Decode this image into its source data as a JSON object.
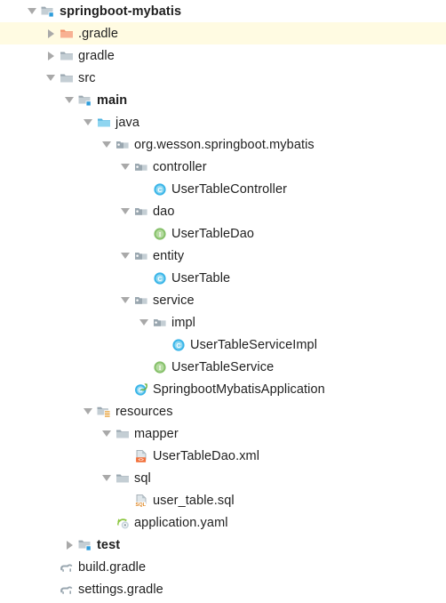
{
  "panel": {
    "name": "project-tool-window-tree",
    "background": "#ffffff",
    "selection_background": "#fffbe2",
    "text_color": "#1f1f1f",
    "arrow_color": "#a9a9a9"
  },
  "colors": {
    "folder_gray": "#9aa7b0",
    "folder_gray_light": "#c4ced4",
    "folder_orange": "#f2926b",
    "folder_orange_light": "#f8b193",
    "folder_blue": "#4eb3e0",
    "folder_blue_light": "#8fd5f0",
    "class_blue": "#3ab5e8",
    "interface_green": "#86c06a",
    "spring_green": "#6db33f",
    "badge_blue": "#2d9cdb",
    "resource_yellow": "#e8a33d",
    "xml_orange": "#f2703a",
    "sql_orange": "#e08b2b",
    "gradle_gray": "#9aa7b0"
  },
  "tree": {
    "rows": [
      {
        "label": "springboot-mybatis",
        "depth": 0,
        "arrow": "expanded",
        "icon": "module-folder-icon",
        "bold": true,
        "selected": false
      },
      {
        "label": ".gradle",
        "depth": 1,
        "arrow": "collapsed",
        "icon": "excluded-folder-icon",
        "bold": false,
        "selected": true
      },
      {
        "label": "gradle",
        "depth": 1,
        "arrow": "collapsed",
        "icon": "folder-icon",
        "bold": false,
        "selected": false
      },
      {
        "label": "src",
        "depth": 1,
        "arrow": "expanded",
        "icon": "folder-icon",
        "bold": false,
        "selected": false
      },
      {
        "label": "main",
        "depth": 2,
        "arrow": "expanded",
        "icon": "module-folder-icon",
        "bold": true,
        "selected": false
      },
      {
        "label": "java",
        "depth": 3,
        "arrow": "expanded",
        "icon": "source-root-folder-icon",
        "bold": false,
        "selected": false
      },
      {
        "label": "org.wesson.springboot.mybatis",
        "depth": 4,
        "arrow": "expanded",
        "icon": "package-icon",
        "bold": false,
        "selected": false
      },
      {
        "label": "controller",
        "depth": 5,
        "arrow": "expanded",
        "icon": "package-icon",
        "bold": false,
        "selected": false
      },
      {
        "label": "UserTableController",
        "depth": 6,
        "arrow": "none",
        "icon": "java-class-icon",
        "bold": false,
        "selected": false
      },
      {
        "label": "dao",
        "depth": 5,
        "arrow": "expanded",
        "icon": "package-icon",
        "bold": false,
        "selected": false
      },
      {
        "label": "UserTableDao",
        "depth": 6,
        "arrow": "none",
        "icon": "java-interface-icon",
        "bold": false,
        "selected": false
      },
      {
        "label": "entity",
        "depth": 5,
        "arrow": "expanded",
        "icon": "package-icon",
        "bold": false,
        "selected": false
      },
      {
        "label": "UserTable",
        "depth": 6,
        "arrow": "none",
        "icon": "java-class-icon",
        "bold": false,
        "selected": false
      },
      {
        "label": "service",
        "depth": 5,
        "arrow": "expanded",
        "icon": "package-icon",
        "bold": false,
        "selected": false
      },
      {
        "label": "impl",
        "depth": 6,
        "arrow": "expanded",
        "icon": "package-icon",
        "bold": false,
        "selected": false
      },
      {
        "label": "UserTableServiceImpl",
        "depth": 7,
        "arrow": "none",
        "icon": "java-class-icon",
        "bold": false,
        "selected": false
      },
      {
        "label": "UserTableService",
        "depth": 6,
        "arrow": "none",
        "icon": "java-interface-icon",
        "bold": false,
        "selected": false
      },
      {
        "label": "SpringbootMybatisApplication",
        "depth": 5,
        "arrow": "none",
        "icon": "spring-boot-class-icon",
        "bold": false,
        "selected": false
      },
      {
        "label": "resources",
        "depth": 3,
        "arrow": "expanded",
        "icon": "resource-root-folder-icon",
        "bold": false,
        "selected": false
      },
      {
        "label": "mapper",
        "depth": 4,
        "arrow": "expanded",
        "icon": "folder-icon",
        "bold": false,
        "selected": false
      },
      {
        "label": "UserTableDao.xml",
        "depth": 5,
        "arrow": "none",
        "icon": "xml-file-icon",
        "bold": false,
        "selected": false
      },
      {
        "label": "sql",
        "depth": 4,
        "arrow": "expanded",
        "icon": "folder-icon",
        "bold": false,
        "selected": false
      },
      {
        "label": "user_table.sql",
        "depth": 5,
        "arrow": "none",
        "icon": "sql-file-icon",
        "bold": false,
        "selected": false
      },
      {
        "label": "application.yaml",
        "depth": 4,
        "arrow": "none",
        "icon": "yaml-file-icon",
        "bold": false,
        "selected": false
      },
      {
        "label": "test",
        "depth": 2,
        "arrow": "collapsed",
        "icon": "module-folder-icon",
        "bold": true,
        "selected": false
      },
      {
        "label": "build.gradle",
        "depth": 1,
        "arrow": "none",
        "icon": "gradle-file-icon",
        "bold": false,
        "selected": false
      },
      {
        "label": "settings.gradle",
        "depth": 1,
        "arrow": "none",
        "icon": "gradle-file-icon",
        "bold": false,
        "selected": false
      }
    ]
  }
}
